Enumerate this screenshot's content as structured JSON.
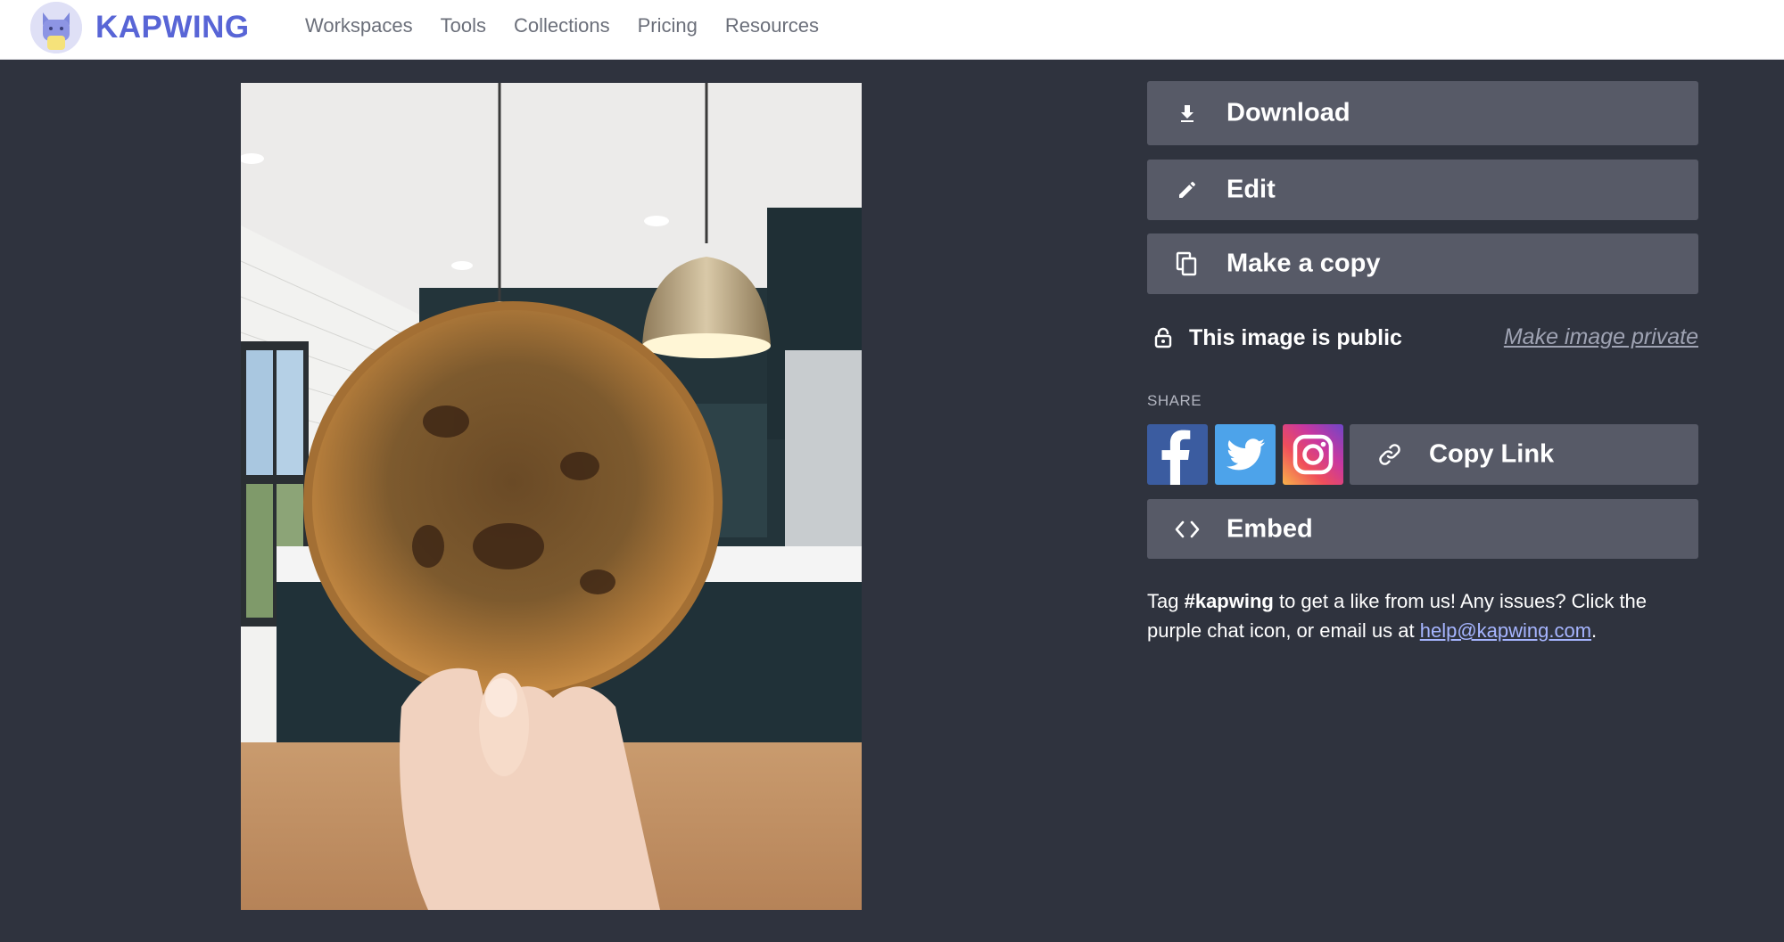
{
  "header": {
    "brand": "KAPWING",
    "nav": [
      "Workspaces",
      "Tools",
      "Collections",
      "Pricing",
      "Resources"
    ]
  },
  "actions": {
    "download": "Download",
    "edit": "Edit",
    "copy": "Make a copy",
    "embed": "Embed"
  },
  "privacy": {
    "status": "This image is public",
    "toggle": "Make image private"
  },
  "share": {
    "label": "SHARE",
    "copy_link": "Copy Link",
    "networks": [
      "facebook-icon",
      "twitter-icon",
      "instagram-icon"
    ]
  },
  "help": {
    "prefix": "Tag ",
    "hashtag": "#kapwing",
    "middle": " to get a like from us! Any issues? Click the purple chat icon, or email us at ",
    "email": "help@kapwing.com",
    "suffix": "."
  },
  "colors": {
    "background": "#2f333e",
    "button": "#575a67",
    "brand": "#5865d6",
    "link": "#a6b5ff"
  }
}
